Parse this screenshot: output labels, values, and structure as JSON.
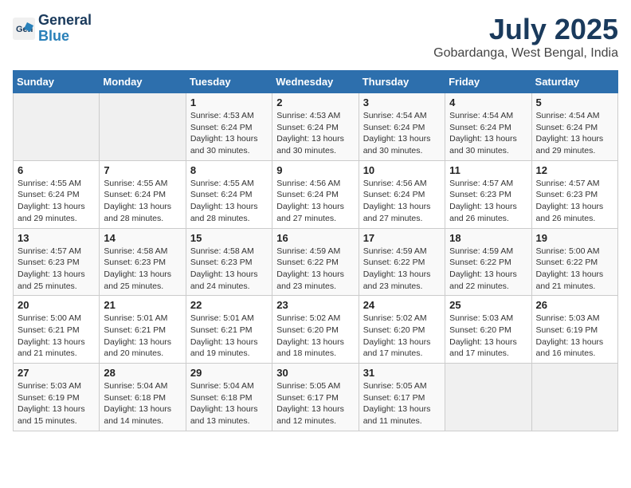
{
  "header": {
    "logo_line1": "General",
    "logo_line2": "Blue",
    "month_year": "July 2025",
    "location": "Gobardanga, West Bengal, India"
  },
  "weekdays": [
    "Sunday",
    "Monday",
    "Tuesday",
    "Wednesday",
    "Thursday",
    "Friday",
    "Saturday"
  ],
  "weeks": [
    [
      {
        "day": "",
        "info": ""
      },
      {
        "day": "",
        "info": ""
      },
      {
        "day": "1",
        "info": "Sunrise: 4:53 AM\nSunset: 6:24 PM\nDaylight: 13 hours and 30 minutes."
      },
      {
        "day": "2",
        "info": "Sunrise: 4:53 AM\nSunset: 6:24 PM\nDaylight: 13 hours and 30 minutes."
      },
      {
        "day": "3",
        "info": "Sunrise: 4:54 AM\nSunset: 6:24 PM\nDaylight: 13 hours and 30 minutes."
      },
      {
        "day": "4",
        "info": "Sunrise: 4:54 AM\nSunset: 6:24 PM\nDaylight: 13 hours and 30 minutes."
      },
      {
        "day": "5",
        "info": "Sunrise: 4:54 AM\nSunset: 6:24 PM\nDaylight: 13 hours and 29 minutes."
      }
    ],
    [
      {
        "day": "6",
        "info": "Sunrise: 4:55 AM\nSunset: 6:24 PM\nDaylight: 13 hours and 29 minutes."
      },
      {
        "day": "7",
        "info": "Sunrise: 4:55 AM\nSunset: 6:24 PM\nDaylight: 13 hours and 28 minutes."
      },
      {
        "day": "8",
        "info": "Sunrise: 4:55 AM\nSunset: 6:24 PM\nDaylight: 13 hours and 28 minutes."
      },
      {
        "day": "9",
        "info": "Sunrise: 4:56 AM\nSunset: 6:24 PM\nDaylight: 13 hours and 27 minutes."
      },
      {
        "day": "10",
        "info": "Sunrise: 4:56 AM\nSunset: 6:24 PM\nDaylight: 13 hours and 27 minutes."
      },
      {
        "day": "11",
        "info": "Sunrise: 4:57 AM\nSunset: 6:23 PM\nDaylight: 13 hours and 26 minutes."
      },
      {
        "day": "12",
        "info": "Sunrise: 4:57 AM\nSunset: 6:23 PM\nDaylight: 13 hours and 26 minutes."
      }
    ],
    [
      {
        "day": "13",
        "info": "Sunrise: 4:57 AM\nSunset: 6:23 PM\nDaylight: 13 hours and 25 minutes."
      },
      {
        "day": "14",
        "info": "Sunrise: 4:58 AM\nSunset: 6:23 PM\nDaylight: 13 hours and 25 minutes."
      },
      {
        "day": "15",
        "info": "Sunrise: 4:58 AM\nSunset: 6:23 PM\nDaylight: 13 hours and 24 minutes."
      },
      {
        "day": "16",
        "info": "Sunrise: 4:59 AM\nSunset: 6:22 PM\nDaylight: 13 hours and 23 minutes."
      },
      {
        "day": "17",
        "info": "Sunrise: 4:59 AM\nSunset: 6:22 PM\nDaylight: 13 hours and 23 minutes."
      },
      {
        "day": "18",
        "info": "Sunrise: 4:59 AM\nSunset: 6:22 PM\nDaylight: 13 hours and 22 minutes."
      },
      {
        "day": "19",
        "info": "Sunrise: 5:00 AM\nSunset: 6:22 PM\nDaylight: 13 hours and 21 minutes."
      }
    ],
    [
      {
        "day": "20",
        "info": "Sunrise: 5:00 AM\nSunset: 6:21 PM\nDaylight: 13 hours and 21 minutes."
      },
      {
        "day": "21",
        "info": "Sunrise: 5:01 AM\nSunset: 6:21 PM\nDaylight: 13 hours and 20 minutes."
      },
      {
        "day": "22",
        "info": "Sunrise: 5:01 AM\nSunset: 6:21 PM\nDaylight: 13 hours and 19 minutes."
      },
      {
        "day": "23",
        "info": "Sunrise: 5:02 AM\nSunset: 6:20 PM\nDaylight: 13 hours and 18 minutes."
      },
      {
        "day": "24",
        "info": "Sunrise: 5:02 AM\nSunset: 6:20 PM\nDaylight: 13 hours and 17 minutes."
      },
      {
        "day": "25",
        "info": "Sunrise: 5:03 AM\nSunset: 6:20 PM\nDaylight: 13 hours and 17 minutes."
      },
      {
        "day": "26",
        "info": "Sunrise: 5:03 AM\nSunset: 6:19 PM\nDaylight: 13 hours and 16 minutes."
      }
    ],
    [
      {
        "day": "27",
        "info": "Sunrise: 5:03 AM\nSunset: 6:19 PM\nDaylight: 13 hours and 15 minutes."
      },
      {
        "day": "28",
        "info": "Sunrise: 5:04 AM\nSunset: 6:18 PM\nDaylight: 13 hours and 14 minutes."
      },
      {
        "day": "29",
        "info": "Sunrise: 5:04 AM\nSunset: 6:18 PM\nDaylight: 13 hours and 13 minutes."
      },
      {
        "day": "30",
        "info": "Sunrise: 5:05 AM\nSunset: 6:17 PM\nDaylight: 13 hours and 12 minutes."
      },
      {
        "day": "31",
        "info": "Sunrise: 5:05 AM\nSunset: 6:17 PM\nDaylight: 13 hours and 11 minutes."
      },
      {
        "day": "",
        "info": ""
      },
      {
        "day": "",
        "info": ""
      }
    ]
  ]
}
